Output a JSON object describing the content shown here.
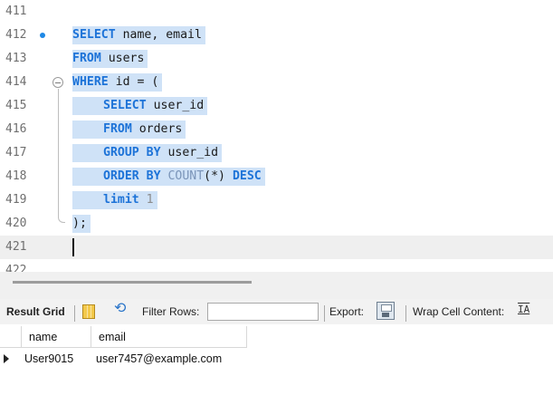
{
  "editor": {
    "lines": [
      {
        "num": "411"
      },
      {
        "num": "412"
      },
      {
        "num": "413"
      },
      {
        "num": "414"
      },
      {
        "num": "415"
      },
      {
        "num": "416"
      },
      {
        "num": "417"
      },
      {
        "num": "418"
      },
      {
        "num": "419"
      },
      {
        "num": "420"
      },
      {
        "num": "421"
      },
      {
        "num": "422"
      }
    ],
    "code": {
      "l412": {
        "kw1": "SELECT",
        "rest": " name, email"
      },
      "l413": {
        "kw1": "FROM",
        "rest": " users"
      },
      "l414": {
        "kw1": "WHERE",
        "rest": " id = ("
      },
      "l415": {
        "kw1": "SELECT",
        "rest": " user_id"
      },
      "l416": {
        "kw1": "FROM",
        "rest": " orders"
      },
      "l417": {
        "kw1": "GROUP BY",
        "rest": " user_id"
      },
      "l418": {
        "kw1": "ORDER BY",
        "fn": " COUNT",
        "rest": "(*) ",
        "kw2": "DESC"
      },
      "l419": {
        "kw1": "limit",
        "sp": " ",
        "num": "1"
      },
      "l420": {
        "rest": ");"
      }
    },
    "colors": {
      "selection": "#cfe2f7",
      "keyword": "#1d73d8",
      "function": "#7b95b9",
      "breakpoint_dot": "#1e88e5"
    }
  },
  "toolbar": {
    "result_grid_label": "Result Grid",
    "grid_icon": "grid-view-icon",
    "refresh_icon": "refresh-icon",
    "filter_label": "Filter Rows:",
    "filter_value": "",
    "export_label": "Export:",
    "export_icon": "save-export-icon",
    "wrap_label": "Wrap Cell Content:",
    "wrap_icon": "wrap-text-icon"
  },
  "results": {
    "columns": [
      "name",
      "email"
    ],
    "rows": [
      [
        "User9015",
        "user7457@example.com"
      ]
    ]
  }
}
